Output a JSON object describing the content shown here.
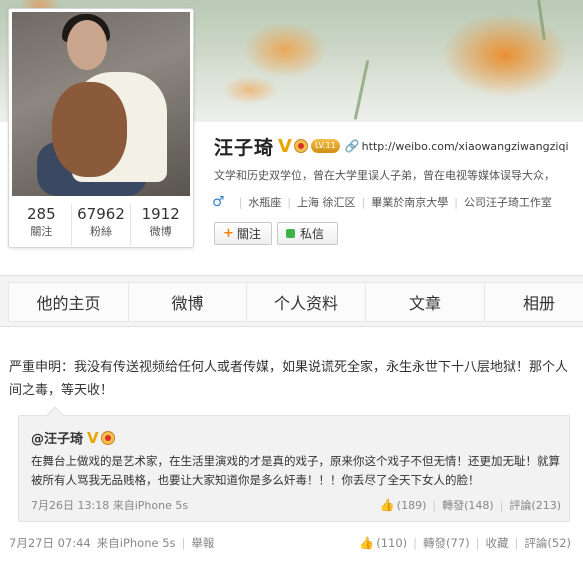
{
  "profile": {
    "name": "汪子琦",
    "level": "LV.11",
    "url": "http://weibo.com/xiaowangziwangziqi",
    "bio": "文学和历史双学位，曾在大学里误人子弟，曾在电视等媒体误导大众，",
    "info": [
      "水瓶座",
      "上海 徐汇区",
      "畢業於南京大學",
      "公司汪子琦工作室"
    ],
    "stats": [
      {
        "num": "285",
        "label": "關注"
      },
      {
        "num": "67962",
        "label": "粉絲"
      },
      {
        "num": "1912",
        "label": "微博"
      }
    ],
    "follow_label": "關注",
    "message_label": "私信"
  },
  "tabs": [
    "他的主页",
    "微博",
    "个人资料",
    "文章",
    "相册"
  ],
  "post": {
    "text": "严重申明：我没有传送视频给任何人或者传媒，如果说谎死全家，永生永世下十八层地狱！那个人间之毒，等天收！",
    "repost": {
      "author": "@汪子琦",
      "text": "在舞台上做戏的是艺术家，在生活里演戏的才是真的戏子，原来你这个戏子不但无情！还更加无耻！就算被所有人骂我无品贱格，也要让大家知道你是多么奸毒！！！你丢尽了全天下女人的脸！",
      "time": "7月26日 13:18",
      "source": "来自iPhone 5s",
      "likes": "(189)",
      "reposts": "轉發(148)",
      "comments": "評論(213)"
    },
    "time": "7月27日 07:44",
    "source": "来自iPhone 5s",
    "report": "舉報",
    "likes": "(110)",
    "reposts": "轉發(77)",
    "favorite": "收藏",
    "comments": "評論(52)"
  },
  "colors": {
    "accent_blue": "#3a7ecf",
    "verified_gold": "#e8a500",
    "follow_orange": "#f08300"
  }
}
